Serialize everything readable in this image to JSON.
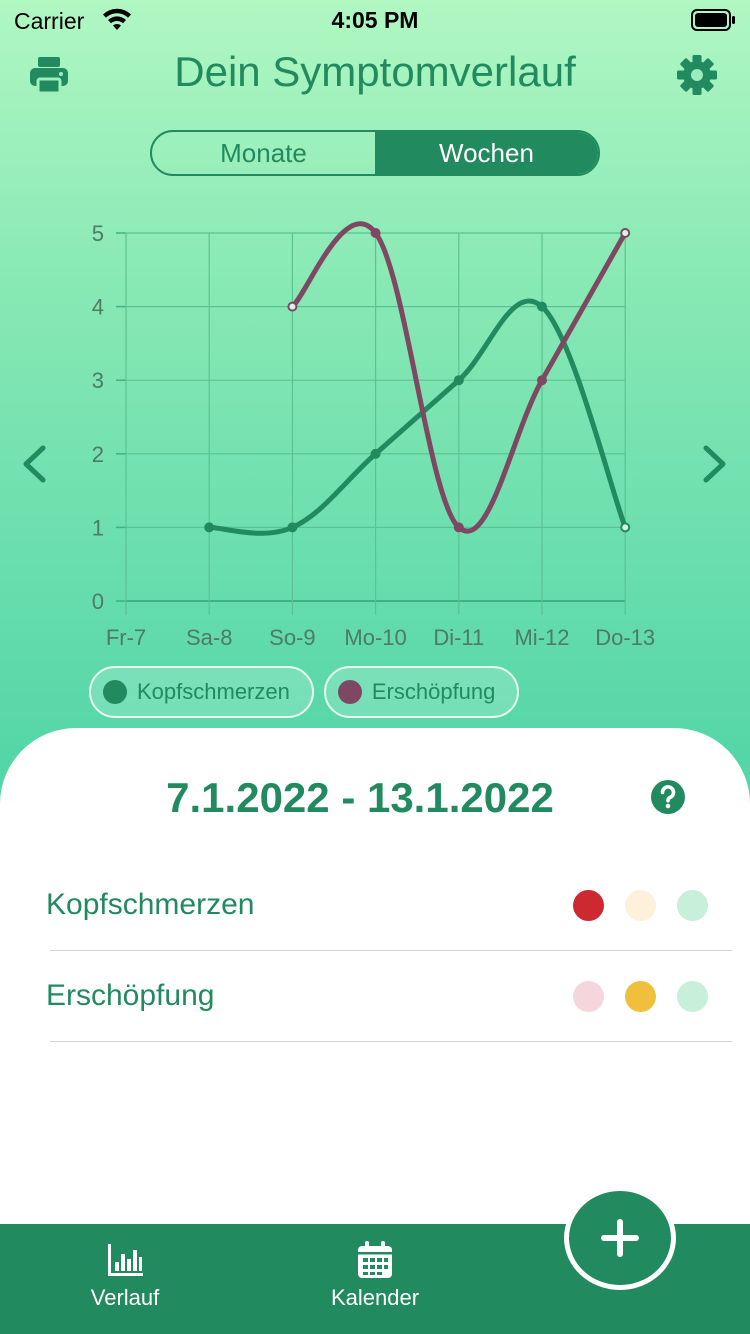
{
  "status_bar": {
    "carrier": "Carrier",
    "time": "4:05 PM"
  },
  "header": {
    "title": "Dein Symptomverlauf",
    "print_icon": "printer-icon",
    "settings_icon": "gear-icon"
  },
  "segment": {
    "options": [
      "Monate",
      "Wochen"
    ],
    "selected": "Wochen"
  },
  "chart_data": {
    "type": "line",
    "categories": [
      "Fr-7",
      "Sa-8",
      "So-9",
      "Mo-10",
      "Di-11",
      "Mi-12",
      "Do-13"
    ],
    "ylim": [
      0,
      5
    ],
    "yticks": [
      0,
      1,
      2,
      3,
      4,
      5
    ],
    "grid": true,
    "series": [
      {
        "name": "Kopfschmerzen",
        "color": "#218a5e",
        "values": [
          null,
          1,
          1,
          2,
          3,
          4,
          1
        ]
      },
      {
        "name": "Erschöpfung",
        "color": "#7e4862",
        "values": [
          null,
          null,
          4,
          5,
          1,
          3,
          5
        ]
      }
    ]
  },
  "legend": [
    {
      "label": "Kopfschmerzen",
      "color": "#218a5e"
    },
    {
      "label": "Erschöpfung",
      "color": "#7e4862"
    }
  ],
  "summary": {
    "date_range": "7.1.2022 - 13.1.2022",
    "help_icon": "help-circle-icon",
    "symptoms": [
      {
        "name": "Kopfschmerzen",
        "dots": [
          "#cc2a30",
          "#fdf1dc",
          "#c8efd9"
        ]
      },
      {
        "name": "Erschöpfung",
        "dots": [
          "#f5d6dc",
          "#f0bf3c",
          "#c8efd9"
        ]
      }
    ]
  },
  "tabs": [
    {
      "label": "Verlauf",
      "icon": "bar-chart-icon"
    },
    {
      "label": "Kalender",
      "icon": "calendar-icon"
    }
  ],
  "fab": {
    "icon": "plus-icon"
  },
  "colors": {
    "primary": "#218a5e",
    "secondary": "#7e4862"
  }
}
